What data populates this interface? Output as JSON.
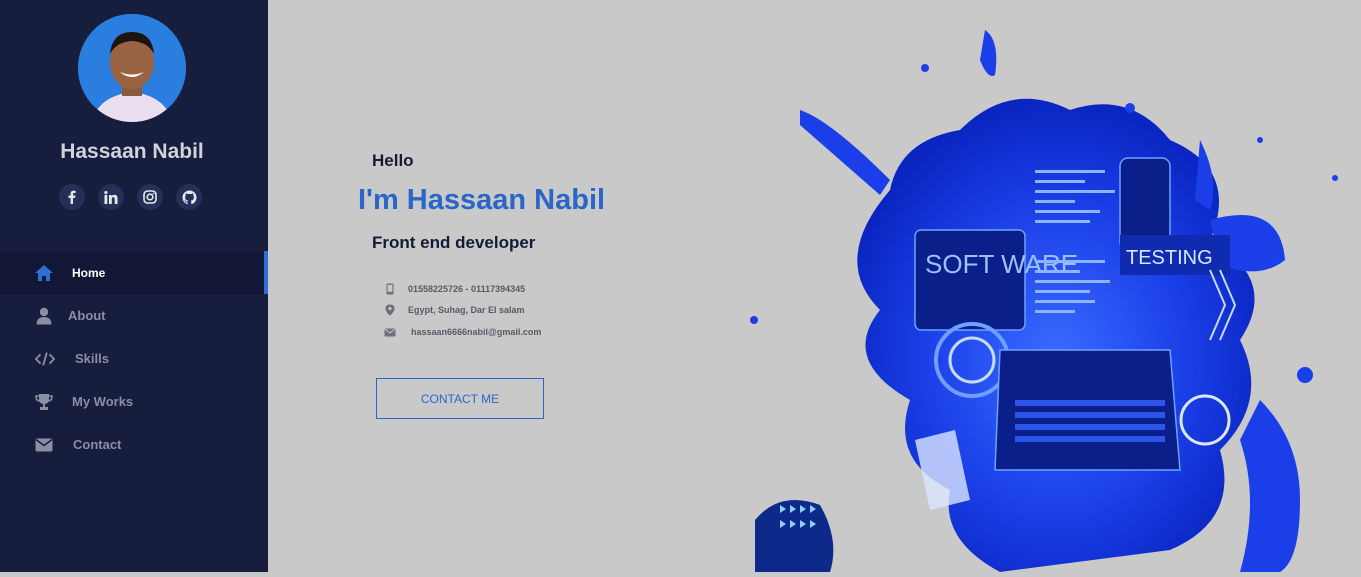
{
  "profile": {
    "name": "Hassaan Nabil"
  },
  "socials": [
    {
      "icon": "facebook-icon"
    },
    {
      "icon": "linkedin-icon"
    },
    {
      "icon": "instagram-icon"
    },
    {
      "icon": "github-icon"
    }
  ],
  "nav": {
    "items": [
      {
        "label": "Home",
        "icon": "home-icon",
        "active": true
      },
      {
        "label": "About",
        "icon": "user-icon",
        "active": false
      },
      {
        "label": "Skills",
        "icon": "code-icon",
        "active": false
      },
      {
        "label": "My Works",
        "icon": "trophy-icon",
        "active": false
      },
      {
        "label": "Contact",
        "icon": "envelope-icon",
        "active": false
      }
    ]
  },
  "hero": {
    "greeting": "Hello",
    "headline": "I'm Hassaan Nabil",
    "role": "Front end developer",
    "phone": "01558225726 - 01117394345",
    "address": "Egypt, Suhag, Dar El salam",
    "email": "hassaan6666nabil@gmail.com",
    "cta_label": "CONTACT ME"
  },
  "illustration": {
    "software_text": "SOFT WARE",
    "testing_text": "TESTING"
  },
  "colors": {
    "sidebar_bg": "#161d3d",
    "page_bg": "#c9c9c9",
    "accent": "#2a66c8",
    "splash": "#1a3fe8"
  }
}
